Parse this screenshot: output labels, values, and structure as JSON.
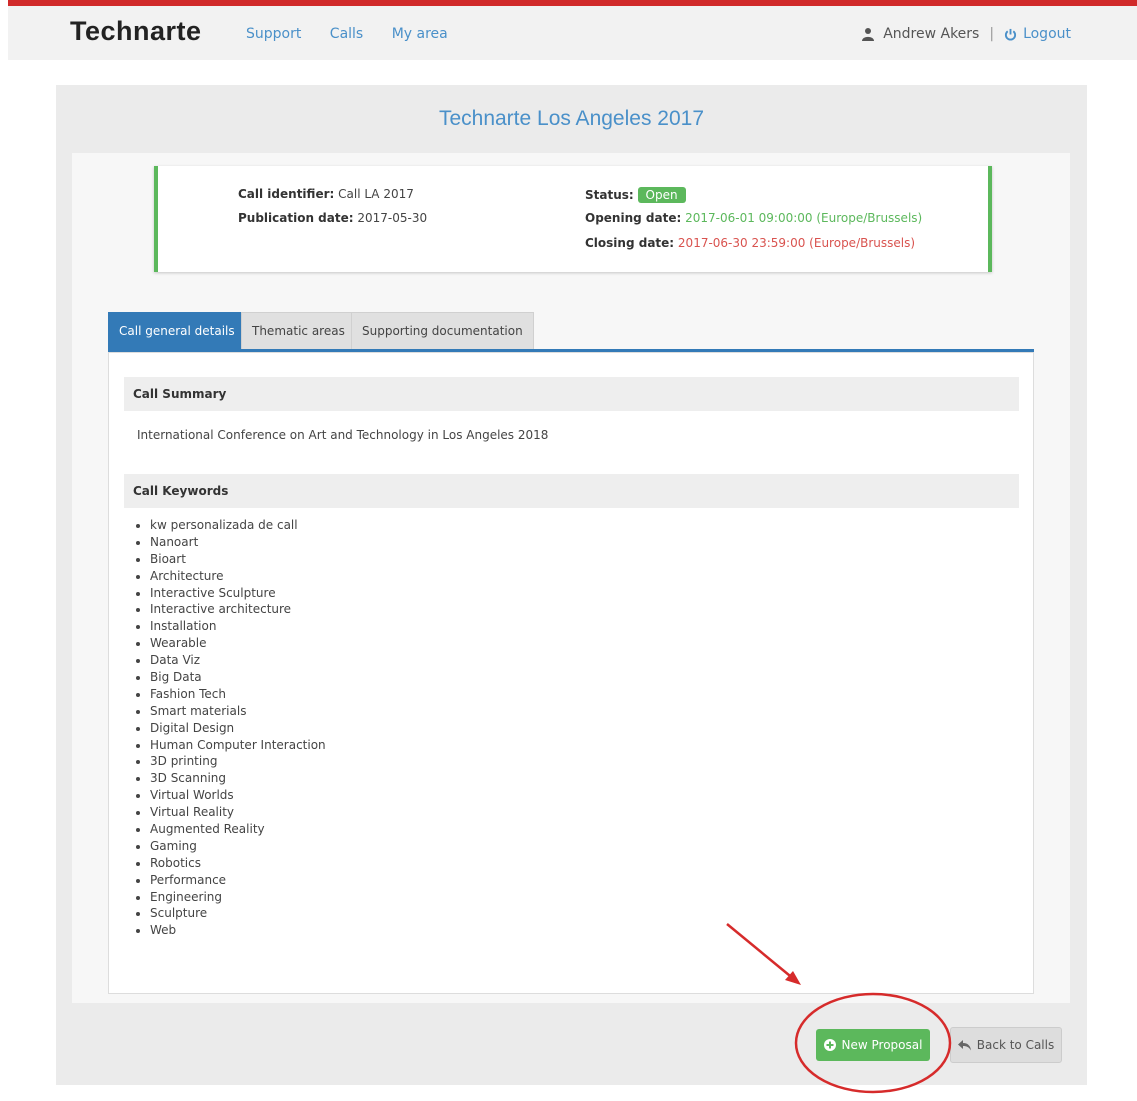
{
  "header": {
    "logo": "Technarte",
    "nav": [
      "Support",
      "Calls",
      "My area"
    ],
    "user_name": "Andrew Akers",
    "separator": "|",
    "logout_label": "Logout"
  },
  "page": {
    "title": "Technarte Los Angeles 2017"
  },
  "call_info": {
    "identifier_label": "Call identifier:",
    "identifier_value": "Call LA 2017",
    "publication_label": "Publication date:",
    "publication_value": "2017-05-30",
    "status_label": "Status:",
    "status_value": "Open",
    "opening_label": "Opening date:",
    "opening_value": "2017-06-01 09:00:00 (Europe/Brussels)",
    "closing_label": "Closing date:",
    "closing_value": "2017-06-30 23:59:00 (Europe/Brussels)"
  },
  "tabs": [
    "Call general details",
    "Thematic areas",
    "Supporting documentation"
  ],
  "summary": {
    "heading": "Call Summary",
    "text": "International Conference on Art and Technology in Los Angeles 2018"
  },
  "keywords": {
    "heading": "Call Keywords",
    "items": [
      "kw personalizada de call",
      "Nanoart",
      "Bioart",
      "Architecture",
      "Interactive Sculpture",
      "Interactive architecture",
      "Installation",
      "Wearable",
      "Data Viz",
      "Big Data",
      "Fashion Tech",
      "Smart materials",
      "Digital Design",
      "Human Computer Interaction",
      "3D printing",
      "3D Scanning",
      "Virtual Worlds",
      "Virtual Reality",
      "Augmented Reality",
      "Gaming",
      "Robotics",
      "Performance",
      "Engineering",
      "Sculpture",
      "Web"
    ]
  },
  "actions": {
    "new_proposal": "New Proposal",
    "back_to_calls": "Back to Calls"
  },
  "colors": {
    "accent": "#337ab7",
    "link": "#4a90c9",
    "success": "#5cb85c",
    "danger": "#d9534f",
    "annotation": "#d62b2b"
  },
  "icons": {
    "user": "user-icon",
    "logout": "power-icon",
    "new_proposal": "plus-circle-icon",
    "back": "reply-arrow-icon"
  }
}
